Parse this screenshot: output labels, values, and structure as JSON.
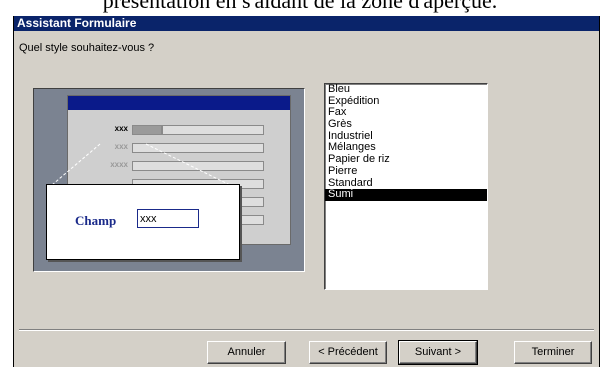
{
  "document": {
    "caption": "présentation en s'aidant de la zone d'aperçue."
  },
  "window": {
    "title": "Assistant Formulaire",
    "question": "Quel style souhaitez-vous ?"
  },
  "preview": {
    "field_label": "Champ",
    "field_value": "xxx",
    "row_label": "xxx",
    "row_faded_label_1": "xxx",
    "row_faded_label_2": "xxxx"
  },
  "styles": {
    "items": [
      "Bleu",
      "Expédition",
      "Fax",
      "Grès",
      "Industriel",
      "Mélanges",
      "Papier de riz",
      "Pierre",
      "Standard",
      "Sumi"
    ],
    "selected": "Sumi"
  },
  "buttons": {
    "cancel": "Annuler",
    "previous": "< Précédent",
    "next": "Suivant >",
    "finish": "Terminer"
  }
}
